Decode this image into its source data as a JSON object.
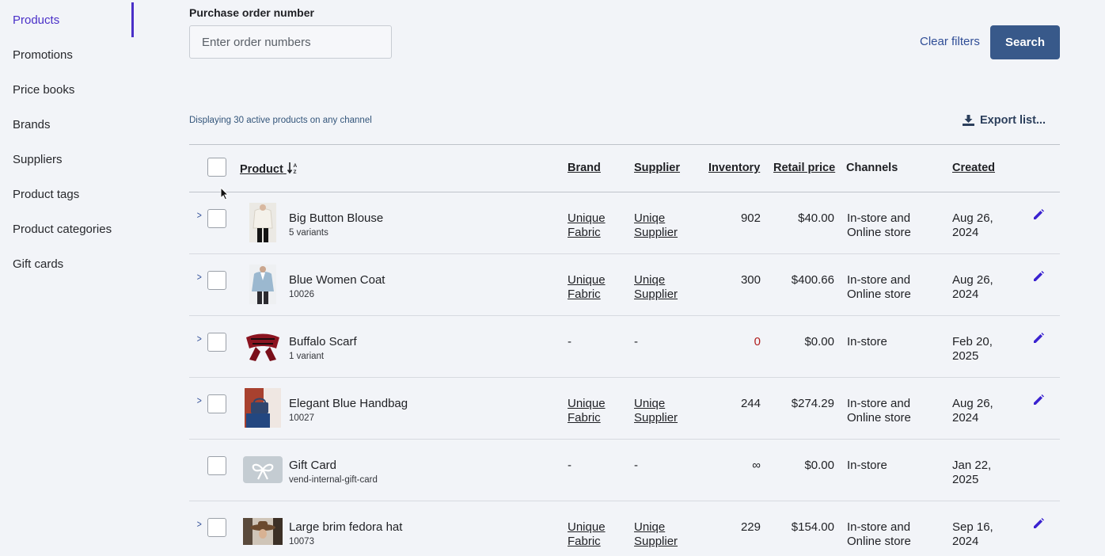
{
  "sidebar": {
    "items": [
      {
        "label": "Products",
        "active": true
      },
      {
        "label": "Promotions"
      },
      {
        "label": "Price books"
      },
      {
        "label": "Brands"
      },
      {
        "label": "Suppliers"
      },
      {
        "label": "Product tags"
      },
      {
        "label": "Product categories"
      },
      {
        "label": "Gift cards"
      }
    ]
  },
  "filters": {
    "label": "Purchase order number",
    "placeholder": "Enter order numbers",
    "clear_label": "Clear filters",
    "search_label": "Search"
  },
  "toolbar": {
    "display_text": "Displaying 30 active products on any channel",
    "export_label": "Export list..."
  },
  "table": {
    "headers": {
      "product": "Product",
      "brand": "Brand",
      "supplier": "Supplier",
      "inventory": "Inventory",
      "retail_price": "Retail price",
      "channels": "Channels",
      "created": "Created"
    },
    "rows": [
      {
        "name": "Big Button Blouse",
        "sub": "5 variants",
        "brand": [
          "Unique",
          "Fabric"
        ],
        "supplier": [
          "Uniqe",
          "Supplier"
        ],
        "inventory": "902",
        "price": "$40.00",
        "channels": [
          "In-store and",
          "Online store"
        ],
        "created": [
          "Aug 26,",
          "2024"
        ],
        "thumb": "blouse"
      },
      {
        "name": "Blue Women Coat",
        "sub": "10026",
        "brand": [
          "Unique",
          "Fabric"
        ],
        "supplier": [
          "Uniqe",
          "Supplier"
        ],
        "inventory": "300",
        "price": "$400.66",
        "channels": [
          "In-store and",
          "Online store"
        ],
        "created": [
          "Aug 26,",
          "2024"
        ],
        "thumb": "coat"
      },
      {
        "name": "Buffalo Scarf",
        "sub": "1 variant",
        "brand": [
          "-"
        ],
        "supplier": [
          "-"
        ],
        "inventory": "0",
        "price": "$0.00",
        "channels": [
          "In-store"
        ],
        "created": [
          "Feb 20,",
          "2025"
        ],
        "thumb": "scarf"
      },
      {
        "name": "Elegant Blue Handbag",
        "sub": "10027",
        "brand": [
          "Unique",
          "Fabric"
        ],
        "supplier": [
          "Uniqe",
          "Supplier"
        ],
        "inventory": "244",
        "price": "$274.29",
        "channels": [
          "In-store and",
          "Online store"
        ],
        "created": [
          "Aug 26,",
          "2024"
        ],
        "thumb": "handbag"
      },
      {
        "name": "Gift Card",
        "sub": "vend-internal-gift-card",
        "brand": [
          "-"
        ],
        "supplier": [
          "-"
        ],
        "inventory": "∞",
        "price": "$0.00",
        "channels": [
          "In-store"
        ],
        "created": [
          "Jan 22,",
          "2025"
        ],
        "thumb": "giftcard"
      },
      {
        "name": "Large brim fedora hat",
        "sub": "10073",
        "brand": [
          "Unique",
          "Fabric"
        ],
        "supplier": [
          "Uniqe",
          "Supplier"
        ],
        "inventory": "229",
        "price": "$154.00",
        "channels": [
          "In-store and",
          "Online store"
        ],
        "created": [
          "Sep 16,",
          "2024"
        ],
        "thumb": "hat"
      }
    ]
  },
  "colors": {
    "accent": "#4a30c8",
    "search_button": "#38598a",
    "link": "#2f4d96",
    "zero_stock": "#b01d1d"
  }
}
